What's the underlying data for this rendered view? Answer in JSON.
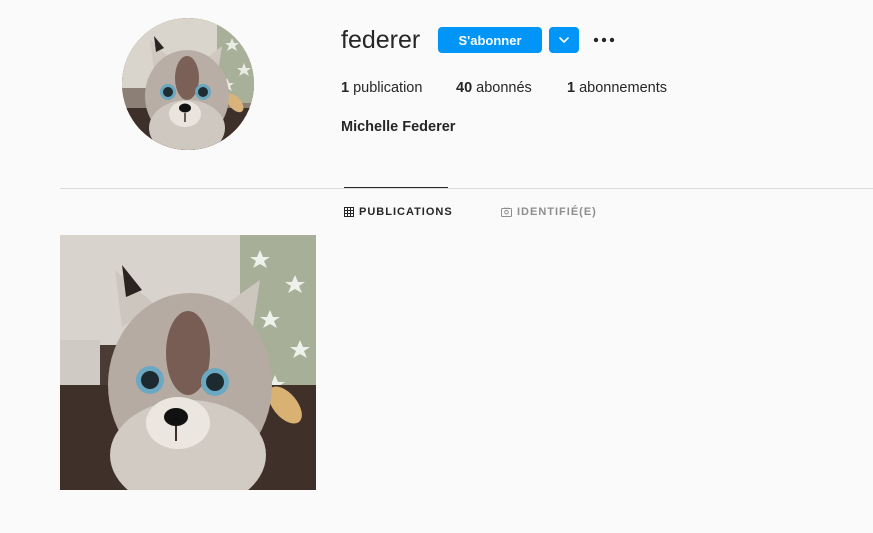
{
  "profile": {
    "username": "federer",
    "follow_label": "S'abonner",
    "full_name": "Michelle Federer"
  },
  "stats": {
    "posts_count": "1",
    "posts_label": "publication",
    "followers_count": "40",
    "followers_label": "abonnés",
    "following_count": "1",
    "following_label": "abonnements"
  },
  "tabs": [
    {
      "label": "PUBLICATIONS",
      "icon": "grid-icon",
      "active": true
    },
    {
      "label": "IDENTIFIÉ(E)",
      "icon": "tagged-icon",
      "active": false
    }
  ],
  "colors": {
    "accent": "#0095f6",
    "text": "#262626",
    "muted": "#8e8e8e",
    "background": "#fafafa",
    "divider": "#dbdbdb"
  },
  "icons": {
    "dropdown": "chevron-down-icon",
    "more": "more-options-icon"
  }
}
